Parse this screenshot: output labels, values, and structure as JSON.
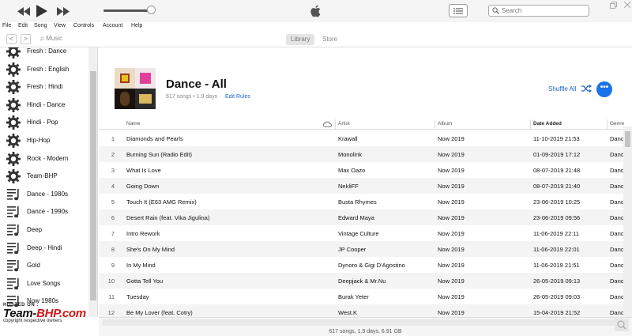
{
  "player": {
    "search_placeholder": "Search"
  },
  "menu": [
    "File",
    "Edit",
    "Song",
    "View",
    "Controls",
    "Account",
    "Help"
  ],
  "nav": {
    "back": "<",
    "forward": ">",
    "media": "Music",
    "tabs": [
      {
        "label": "Library",
        "active": true
      },
      {
        "label": "Store",
        "active": false
      }
    ]
  },
  "sidebar": {
    "items": [
      {
        "label": "Fresh : Dance",
        "icon": "gear-icon"
      },
      {
        "label": "Fresh : English",
        "icon": "gear-icon"
      },
      {
        "label": "Fresh : Hindi",
        "icon": "gear-icon"
      },
      {
        "label": "Hindi - Dance",
        "icon": "gear-icon"
      },
      {
        "label": "Hindi - Pop",
        "icon": "gear-icon"
      },
      {
        "label": "Hip-Hop",
        "icon": "gear-icon"
      },
      {
        "label": "Rock - Modern",
        "icon": "gear-icon"
      },
      {
        "label": "Team-BHP",
        "icon": "gear-icon"
      },
      {
        "label": "Dance - 1980s",
        "icon": "playlist-icon"
      },
      {
        "label": "Dance - 1990s",
        "icon": "playlist-icon"
      },
      {
        "label": "Deep",
        "icon": "playlist-icon"
      },
      {
        "label": "Deep - Hindi",
        "icon": "playlist-icon"
      },
      {
        "label": "Gold",
        "icon": "playlist-icon"
      },
      {
        "label": "Love Songs",
        "icon": "playlist-icon"
      },
      {
        "label": "Now 1980s",
        "icon": "playlist-icon"
      }
    ]
  },
  "watermark": {
    "hosted": "HOSTED ON :",
    "brand_left": "Team-",
    "brand_right": "BHP.com",
    "copyright": "copyright respective owners"
  },
  "playlist": {
    "title": "Dance - All",
    "meta": "617 songs • 1.9 days",
    "edit_rules": "Edit Rules",
    "shuffle": "Shuffle All",
    "more": "•••"
  },
  "table": {
    "headers": {
      "name": "Name",
      "artist": "Artist",
      "album": "Album",
      "date_added": "Date Added",
      "genre": "Genre"
    },
    "rows": [
      {
        "num": "1",
        "name": "Diamonds and Pearls",
        "artist": "Krawall",
        "album": "Now 2019",
        "date": "11-10-2019 21:53",
        "genre": "Dance"
      },
      {
        "num": "2",
        "name": "Burning Sun (Radio Edit)",
        "artist": "Monolink",
        "album": "Now 2019",
        "date": "01-09-2019 17:12",
        "genre": "Dance"
      },
      {
        "num": "3",
        "name": "What Is Love",
        "artist": "Max Oazo",
        "album": "Now 2019",
        "date": "08-07-2019 21:48",
        "genre": "Dance"
      },
      {
        "num": "4",
        "name": "Going Down",
        "artist": "NekliFF",
        "album": "Now 2019",
        "date": "08-07-2019 21:40",
        "genre": "Dance"
      },
      {
        "num": "5",
        "name": "Touch It (E63 AMG Remix)",
        "artist": "Busta Rhymes",
        "album": "Now 2019",
        "date": "23-06-2019 10:25",
        "genre": "Dance"
      },
      {
        "num": "6",
        "name": "Desert Rain (feat. Vika Jigulina)",
        "artist": "Edward Maya",
        "album": "Now 2019",
        "date": "23-06-2019 09:56",
        "genre": "Dance"
      },
      {
        "num": "7",
        "name": "Intro Rework",
        "artist": "Vintage Culture",
        "album": "Now 2019",
        "date": "11-06-2019 22:11",
        "genre": "Dance"
      },
      {
        "num": "8",
        "name": "She's On My Mind",
        "artist": "JP Cooper",
        "album": "Now 2019",
        "date": "11-06-2019 22:01",
        "genre": "Dance"
      },
      {
        "num": "9",
        "name": "In My Mind",
        "artist": "Dynoro & Gigi D'Agostino",
        "album": "Now 2019",
        "date": "11-06-2019 21:51",
        "genre": "Dance"
      },
      {
        "num": "10",
        "name": "Gotta Tell You",
        "artist": "Deepjack & Mr.Nu",
        "album": "Now 2019",
        "date": "26-05-2019 09:13",
        "genre": "Dance"
      },
      {
        "num": "11",
        "name": "Tuesday",
        "artist": "Burak Yeter",
        "album": "Now 2019",
        "date": "26-05-2019 09:03",
        "genre": "Dance"
      },
      {
        "num": "12",
        "name": "Be My Lover (feat. Cotry)",
        "artist": "West.K",
        "album": "Now 2019",
        "date": "15-04-2019 21:52",
        "genre": "Dance"
      }
    ]
  },
  "status": "617 songs, 1.9 days, 6.91 GB",
  "colors": {
    "accent": "#1a73e8",
    "link": "#1a64c8",
    "watermark_red": "#d01818"
  }
}
